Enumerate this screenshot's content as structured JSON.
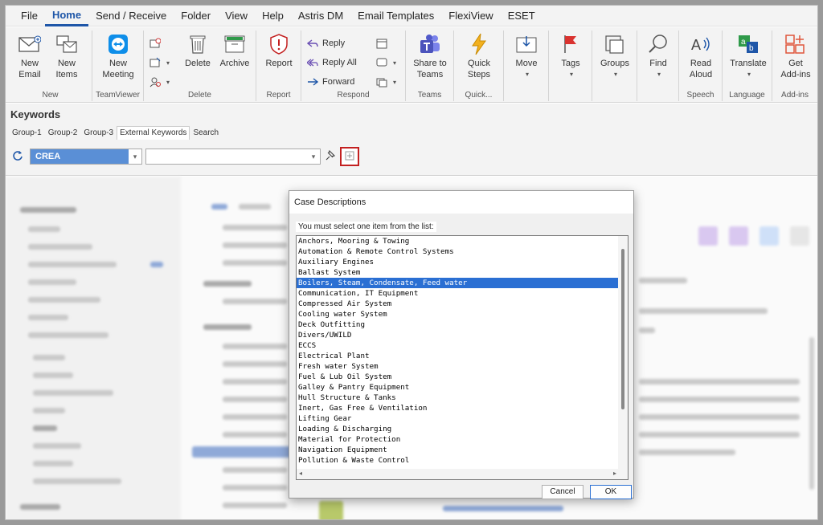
{
  "menu": [
    "File",
    "Home",
    "Send / Receive",
    "Folder",
    "View",
    "Help",
    "Astris DM",
    "Email Templates",
    "FlexiView",
    "ESET"
  ],
  "menu_active": "Home",
  "ribbon": {
    "new_email": "New Email",
    "new_items": "New Items",
    "new_group": "New",
    "new_meeting": "New Meeting",
    "teamviewer_group": "TeamViewer",
    "delete": "Delete",
    "archive": "Archive",
    "delete_group": "Delete",
    "report": "Report",
    "report_group": "Report",
    "reply": "Reply",
    "reply_all": "Reply All",
    "forward": "Forward",
    "respond_group": "Respond",
    "share_teams": "Share to Teams",
    "teams_group": "Teams",
    "quick_steps": "Quick Steps",
    "quick_group": "Quick...",
    "move": "Move",
    "tags": "Tags",
    "groups": "Groups",
    "find": "Find",
    "read_aloud": "Read Aloud",
    "speech_group": "Speech",
    "translate": "Translate",
    "language_group": "Language",
    "get_addins": "Get Add-ins",
    "addins_group": "Add-ins"
  },
  "keywords": {
    "title": "Keywords",
    "tabs": [
      "Group-1",
      "Group-2",
      "Group-3",
      "External Keywords",
      "Search"
    ],
    "selected_tab": "External Keywords",
    "combo_value": "CREA",
    "combo2_value": ""
  },
  "dialog": {
    "title": "Case Descriptions",
    "prompt": "You must select one item from the list:",
    "items": [
      "Anchors, Mooring & Towing",
      "Automation & Remote Control Systems",
      "Auxiliary Engines",
      "Ballast System",
      "Boilers, Steam, Condensate, Feed water",
      "Communication, IT Equipment",
      "Compressed Air System",
      "Cooling water System",
      "Deck Outfitting",
      "Divers/UWILD",
      "ECCS",
      "Electrical Plant",
      "Fresh water System",
      "Fuel & Lub Oil System",
      "Galley & Pantry Equipment",
      "Hull Structure & Tanks",
      "Inert, Gas Free & Ventilation",
      "Lifting Gear",
      "Loading & Discharging",
      "Material for Protection",
      "Navigation Equipment",
      "Pollution & Waste Control"
    ],
    "selected_index": 4,
    "cancel": "Cancel",
    "ok": "OK"
  },
  "colors": {
    "accent": "#1e56a8",
    "selection": "#2a6fd3",
    "highlight_border": "#c32020"
  }
}
